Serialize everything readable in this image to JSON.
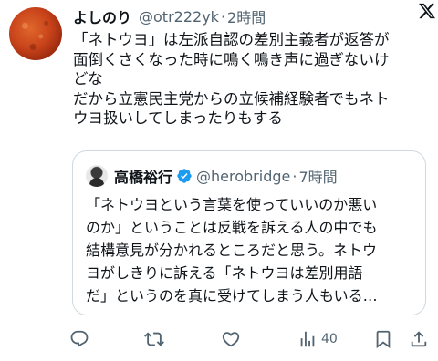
{
  "post": {
    "author_name": "よしのり",
    "handle": "@otr222yk",
    "separator": "·",
    "time": "2時間",
    "text_lines": [
      "「ネトウヨ」は左派自認の差別主義者が返答が",
      "面倒くさくなった時に鳴く鳴き声に過ぎないけ",
      "どな",
      "だから立憲民主党からの立候補経験者でもネト",
      "ウヨ扱いしてしまったりもする"
    ]
  },
  "quote": {
    "author_name": "高橋裕行",
    "handle": "@herobridge",
    "separator": "·",
    "time": "7時間",
    "text_lines": [
      "「ネトウヨという言葉を使っていいのか悪い",
      "のか」ということは反戦を訴える人の中でも",
      "結構意見が分かれるところだと思う。ネトウ",
      "ヨがしきりに訴える「ネトウヨは差別用語",
      "だ」というのを真に受けてしまう人もいる…"
    ]
  },
  "actions": {
    "views_count": "40"
  },
  "icons": {
    "logo": "x-logo-icon",
    "reply": "reply-icon",
    "repost": "repost-icon",
    "like": "like-icon",
    "views": "views-icon",
    "bookmark": "bookmark-icon",
    "share": "share-icon",
    "verified": "verified-badge-icon"
  },
  "colors": {
    "text": "#0f1419",
    "secondary": "#536471",
    "border": "#cfd9de",
    "verified": "#1d9bf0"
  }
}
